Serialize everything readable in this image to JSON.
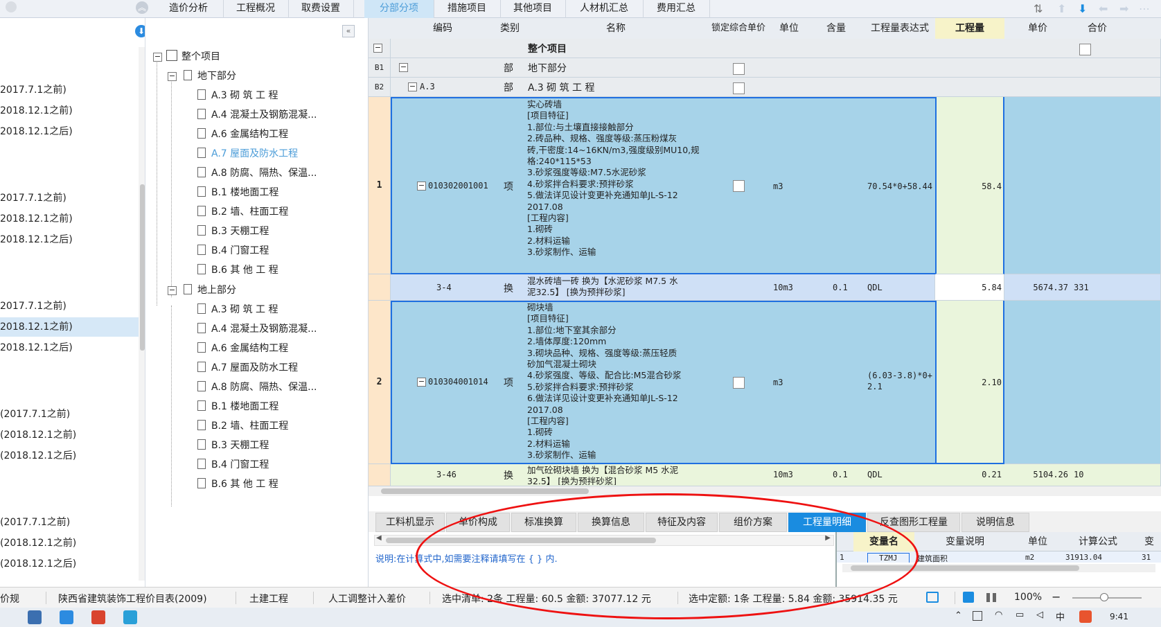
{
  "topbar": {
    "tabs": [
      "造价分析",
      "工程概况",
      "取费设置",
      "分部分项",
      "措施项目",
      "其他项目",
      "人材机汇总",
      "费用汇总"
    ],
    "active": "分部分项"
  },
  "leftpane": {
    "rows": [
      "2017.7.1之前)",
      "2018.12.1之前)",
      "2018.12.1之后)",
      "2017.7.1之前)",
      "2018.12.1之前)",
      "2018.12.1之后)",
      "2017.7.1之前)",
      "2018.12.1之前)",
      "2018.12.1之后)",
      "(2017.7.1之前)",
      "(2018.12.1之前)",
      "(2018.12.1之后)",
      "(2017.7.1之前)",
      "(2018.12.1之前)",
      "(2018.12.1之后)"
    ]
  },
  "tree": {
    "root": "整个项目",
    "underground": {
      "label": "地下部分",
      "items": [
        "A.3  砌 筑 工 程",
        "A.4  混凝土及钢筋混凝...",
        "A.6  金属结构工程",
        "A.7  屋面及防水工程",
        "A.8  防腐、隔热、保温...",
        "B.1  楼地面工程",
        "B.2  墙、柱面工程",
        "B.3  天棚工程",
        "B.4  门窗工程",
        "B.6  其 他 工 程"
      ]
    },
    "aboveground": {
      "label": "地上部分",
      "items": [
        "A.3  砌 筑 工 程",
        "A.4  混凝土及钢筋混凝...",
        "A.6  金属结构工程",
        "A.7  屋面及防水工程",
        "A.8  防腐、隔热、保温...",
        "B.1  楼地面工程",
        "B.2  墙、柱面工程",
        "B.3  天棚工程",
        "B.4  门窗工程",
        "B.6  其 他 工 程"
      ]
    }
  },
  "grid": {
    "headers": [
      "编码",
      "类别",
      "名称",
      "锁定综合单价",
      "单位",
      "含量",
      "工程量表达式",
      "工程量",
      "单价",
      "合价"
    ],
    "row_root": {
      "name": "整个项目"
    },
    "row_b1": {
      "idx": "B1",
      "cat": "部",
      "name": "地下部分"
    },
    "row_b2": {
      "idx": "B2",
      "code": "A.3",
      "cat": "部",
      "name": "A.3  砌 筑 工 程"
    },
    "row1": {
      "idx": "1",
      "code": "010302001001",
      "cat": "项",
      "unit": "m3",
      "expr": "70.54*0+58.44",
      "qty": "58.4",
      "name": [
        "实心砖墙",
        "[项目特征]",
        "1.部位:与土壤直接接触部分",
        "2.砖品种、规格、强度等级:蒸压粉煤灰",
        "砖,干密度:14~16KN/m3,强度级别MU10,规",
        "格:240*115*53",
        "3.砂浆强度等级:M7.5水泥砂浆",
        "4.砂浆拌合料要求:预拌砂浆",
        "5.做法详见设计变更补充通知单JL-S-12",
        "2017.08",
        "[工程内容]",
        "1.砌砖",
        "2.材料运输",
        "3.砂浆制作、运输"
      ]
    },
    "row1sub": {
      "code": "3-4",
      "cat": "换",
      "name": [
        "混水砖墙一砖  换为【水泥砂浆 M7.5 水",
        "泥32.5】  [换为预拌砂浆]"
      ],
      "unit": "10m3",
      "content": "0.1",
      "expr": "QDL",
      "qty": "5.84",
      "price": "5674.37",
      "total": "331"
    },
    "row2": {
      "idx": "2",
      "code": "010304001014",
      "cat": "项",
      "unit": "m3",
      "expr": "(6.03-3.8)*0+2.1",
      "qty": "2.10",
      "name": [
        "砌块墙",
        "[项目特征]",
        "1.部位:地下室其余部分",
        "2.墙体厚度:120mm",
        "3.砌块品种、规格、强度等级:蒸压轻质",
        "砂加气混凝土砌块",
        "4.砂浆强度、等级、配合比:M5混合砂浆",
        "5.砂浆拌合料要求:预拌砂浆",
        "6.做法详见设计变更补充通知单JL-S-12",
        "2017.08",
        "[工程内容]",
        "1.砌砖",
        "2.材料运输",
        "3.砂浆制作、运输"
      ]
    },
    "row2sub": {
      "code": "3-46",
      "cat": "换",
      "name": [
        "加气砼砌块墙  换为【混合砂浆 M5 水泥",
        "32.5】 [换为预拌砂浆]"
      ],
      "unit": "10m3",
      "content": "0.1",
      "expr": "QDL",
      "qty": "0.21",
      "price": "5104.26",
      "total": "10"
    }
  },
  "lowtabs": {
    "tabs": [
      "工料机显示",
      "单价构成",
      "标准换算",
      "换算信息",
      "特征及内容",
      "组价方案",
      "工程量明细",
      "反查图形工程量",
      "说明信息"
    ],
    "active": "工程量明细"
  },
  "detail": {
    "note": "说明:在计算式中,如需要注释请填写在 { } 内.",
    "headers": [
      "变量名",
      "变量说明",
      "单位",
      "计算公式",
      "变"
    ],
    "row": {
      "idx": "1",
      "var": "TZMJ",
      "desc": "建筑面积",
      "unit": "m2",
      "formula": "31913.04",
      "extra": "31"
    }
  },
  "status": {
    "items": [
      "价规",
      "陕西省建筑装饰工程价目表(2009)",
      "土建工程",
      "人工调整计入差价"
    ],
    "sel_list": "选中清单: 2条  工程量: 60.5  金额: 37077.12 元",
    "sel_quota": "选中定额: 1条  工程量: 5.84  金额: 35914.35 元",
    "zoom": "100%"
  },
  "taskbar": {
    "time": "9:41"
  },
  "colors": {
    "accent": "#1a8ce0",
    "selected_blue": "#a7d3e9",
    "annotation": "#e11111"
  }
}
